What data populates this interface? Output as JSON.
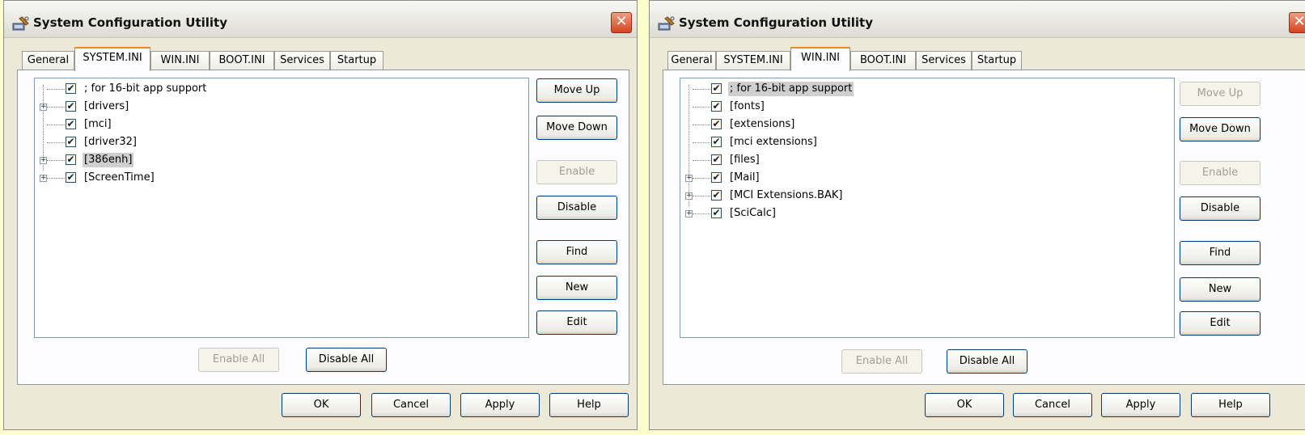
{
  "windows": [
    {
      "title": "System Configuration Utility",
      "close_glyph": "✕",
      "tabs": [
        "General",
        "SYSTEM.INI",
        "WIN.INI",
        "BOOT.INI",
        "Services",
        "Startup"
      ],
      "active_tab": "SYSTEM.INI",
      "tree_items": [
        {
          "label": "; for 16-bit app support",
          "checked": true,
          "expandable": false,
          "selected": false
        },
        {
          "label": "[drivers]",
          "checked": true,
          "expandable": true,
          "selected": false
        },
        {
          "label": "[mci]",
          "checked": true,
          "expandable": false,
          "selected": false
        },
        {
          "label": "[driver32]",
          "checked": true,
          "expandable": false,
          "selected": false
        },
        {
          "label": "[386enh]",
          "checked": true,
          "expandable": true,
          "selected": true
        },
        {
          "label": "[ScreenTime]",
          "checked": true,
          "expandable": true,
          "selected": false
        }
      ],
      "side_buttons": [
        {
          "label": "Move Up",
          "enabled": true
        },
        {
          "label": "Move Down",
          "enabled": true
        },
        {
          "label": "Enable",
          "enabled": false
        },
        {
          "label": "Disable",
          "enabled": true
        },
        {
          "label": "Find",
          "enabled": true
        },
        {
          "label": "New",
          "enabled": true
        },
        {
          "label": "Edit",
          "enabled": true
        }
      ],
      "bottom_buttons": [
        {
          "label": "Enable All",
          "enabled": false
        },
        {
          "label": "Disable All",
          "enabled": true
        }
      ],
      "footer_buttons": [
        "OK",
        "Cancel",
        "Apply",
        "Help"
      ]
    },
    {
      "title": "System Configuration Utility",
      "close_glyph": "✕",
      "tabs": [
        "General",
        "SYSTEM.INI",
        "WIN.INI",
        "BOOT.INI",
        "Services",
        "Startup"
      ],
      "active_tab": "WIN.INI",
      "tree_items": [
        {
          "label": "; for 16-bit app support",
          "checked": true,
          "expandable": false,
          "selected": true
        },
        {
          "label": "[fonts]",
          "checked": true,
          "expandable": false,
          "selected": false
        },
        {
          "label": "[extensions]",
          "checked": true,
          "expandable": false,
          "selected": false
        },
        {
          "label": "[mci extensions]",
          "checked": true,
          "expandable": false,
          "selected": false
        },
        {
          "label": "[files]",
          "checked": true,
          "expandable": false,
          "selected": false
        },
        {
          "label": "[Mail]",
          "checked": true,
          "expandable": true,
          "selected": false
        },
        {
          "label": "[MCI Extensions.BAK]",
          "checked": true,
          "expandable": true,
          "selected": false
        },
        {
          "label": "[SciCalc]",
          "checked": true,
          "expandable": true,
          "selected": false
        }
      ],
      "side_buttons": [
        {
          "label": "Move Up",
          "enabled": false
        },
        {
          "label": "Move Down",
          "enabled": true
        },
        {
          "label": "Enable",
          "enabled": false
        },
        {
          "label": "Disable",
          "enabled": true
        },
        {
          "label": "Find",
          "enabled": true
        },
        {
          "label": "New",
          "enabled": true
        },
        {
          "label": "Edit",
          "enabled": true
        }
      ],
      "bottom_buttons": [
        {
          "label": "Enable All",
          "enabled": false
        },
        {
          "label": "Disable All",
          "enabled": true
        }
      ],
      "footer_buttons": [
        "OK",
        "Cancel",
        "Apply",
        "Help"
      ]
    }
  ],
  "glyphs": {
    "check": "✔",
    "expand": "+"
  },
  "colors": {
    "background": "#fdfccc",
    "dialog": "#ece9d8",
    "active_tab_accent": "#e68b2c",
    "selection": "#cfcfcf",
    "button_border": "#003c74",
    "close_button": "#d5431f"
  }
}
